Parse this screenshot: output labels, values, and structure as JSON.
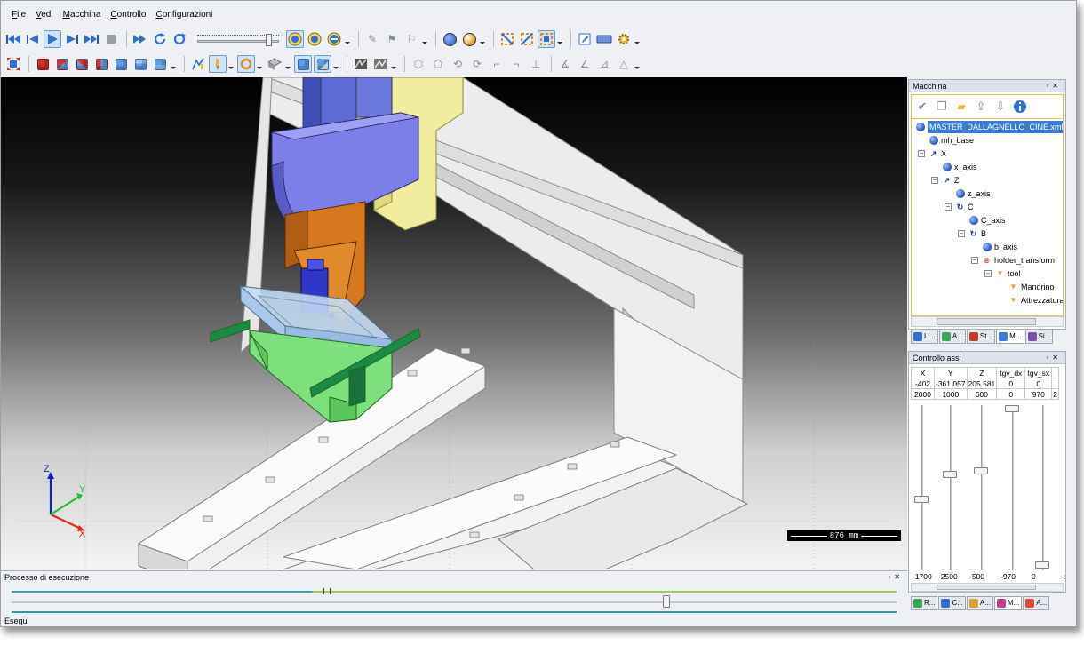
{
  "menu": [
    "File",
    "Vedi",
    "Macchina",
    "Controllo",
    "Configurazioni"
  ],
  "toolbar": {
    "playback_icons": [
      "skip-start-icon",
      "step-back-icon",
      "play-icon",
      "step-forward-icon",
      "skip-end-icon",
      "stop-icon"
    ],
    "speed_fraction": 0.9
  },
  "viewport": {
    "axes": {
      "z": "Z",
      "y": "Y",
      "x": "X"
    },
    "scale_label": "876 mm"
  },
  "macchina": {
    "title": "Macchina",
    "tree": [
      {
        "label": "MASTER_DALLAGNELLO_CINE.xml",
        "level": 0,
        "icon": "machine-icon",
        "selected": true
      },
      {
        "label": "mh_base",
        "level": 1,
        "icon": "sphere-icon"
      },
      {
        "label": "X",
        "level": 1,
        "icon": "linear-axis-icon"
      },
      {
        "label": "x_axis",
        "level": 2,
        "icon": "sphere-icon"
      },
      {
        "label": "Z",
        "level": 2,
        "icon": "linear-axis-icon"
      },
      {
        "label": "z_axis",
        "level": 3,
        "icon": "sphere-icon"
      },
      {
        "label": "C",
        "level": 3,
        "icon": "rotary-axis-icon"
      },
      {
        "label": "C_axis",
        "level": 4,
        "icon": "sphere-icon"
      },
      {
        "label": "B",
        "level": 4,
        "icon": "rotary-axis-icon"
      },
      {
        "label": "b_axis",
        "level": 5,
        "icon": "sphere-icon"
      },
      {
        "label": "holder_transform",
        "level": 5,
        "icon": "transform-icon"
      },
      {
        "label": "tool",
        "level": 6,
        "icon": "tool-icon"
      },
      {
        "label": "Mandrino",
        "level": 7,
        "icon": "tool-icon"
      },
      {
        "label": "Attrezzatura",
        "level": 7,
        "icon": "tool-icon"
      }
    ],
    "tabs": [
      {
        "label": "Li...",
        "color": "#2f6fd0"
      },
      {
        "label": "A...",
        "color": "#3aa655"
      },
      {
        "label": "St...",
        "color": "#c23a2a"
      },
      {
        "label": "M...",
        "color": "#3d7bd9"
      },
      {
        "label": "Si...",
        "color": "#7a4fb0"
      }
    ]
  },
  "assi": {
    "title": "Controllo assi",
    "columns": [
      "X",
      "Y",
      "Z",
      "tgv_dx",
      "tgv_sx"
    ],
    "current": [
      "-402",
      "-361.057",
      "205.581",
      "0",
      "0"
    ],
    "max": [
      "2000",
      "1000",
      "600",
      "0",
      "970"
    ],
    "min": [
      "-1700",
      "-2500",
      "-500",
      "-970",
      "0"
    ],
    "overflow_marker": "2",
    "overflow_min": "-:",
    "slider_fraction": [
      0.42,
      0.58,
      0.6,
      1.0,
      0.0
    ],
    "tabs": [
      {
        "label": "R...",
        "color": "#3aa655"
      },
      {
        "label": "C...",
        "color": "#2f6fd0"
      },
      {
        "label": "A...",
        "color": "#d9a23a"
      },
      {
        "label": "M...",
        "color": "#c23a8a"
      },
      {
        "label": "A...",
        "color": "#d94f3a"
      }
    ]
  },
  "processo": {
    "title": "Processo di esecuzione",
    "progress_fraction": 0.34,
    "slider_fraction": 0.74
  },
  "status": "Esegui"
}
